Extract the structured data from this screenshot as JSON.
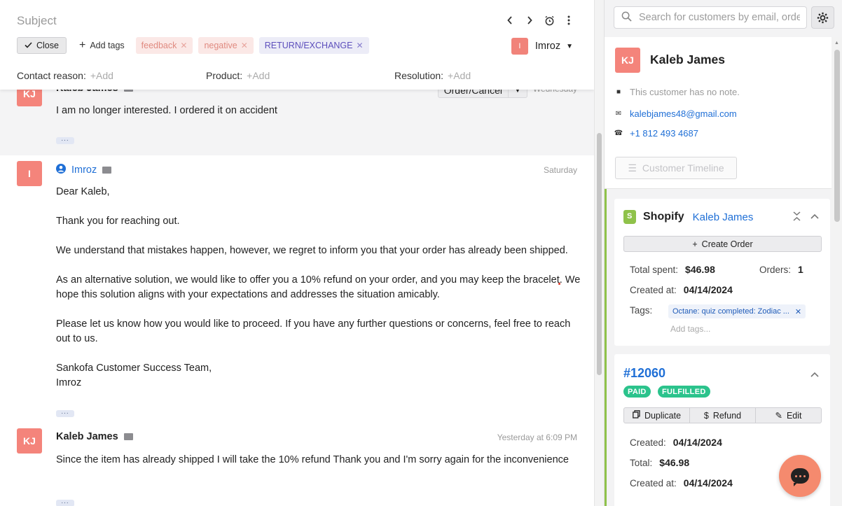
{
  "header": {
    "subject_placeholder": "Subject",
    "close_label": "Close",
    "add_tags_label": "Add tags",
    "tags": [
      "feedback",
      "negative",
      "RETURN/EXCHANGE"
    ],
    "assignee_initial": "I",
    "assignee_name": "Imroz",
    "fields": [
      {
        "label": "Contact reason:",
        "value": "+Add"
      },
      {
        "label": "Product:",
        "value": "+Add"
      },
      {
        "label": "Resolution:",
        "value": "+Add"
      }
    ],
    "icons": [
      "chevron-left-icon",
      "chevron-right-icon",
      "snooze-clock-icon",
      "more-vertical-icon"
    ]
  },
  "messages": [
    {
      "initials": "KJ",
      "sender": "Kaleb James",
      "time": "Wednesday",
      "intent": "Order/Cancel",
      "paragraphs": [
        "I am no longer interested. I ordered it on accident"
      ]
    },
    {
      "initials": "I",
      "sender": "Imroz",
      "time": "Saturday",
      "paragraphs": [
        "Dear Kaleb,",
        "Thank you for reaching out.",
        "We understand that mistakes happen, however, we regret to inform you that your order has already been shipped.",
        "As an alternative solution, we would like to offer you a 10% refund on your order, and you may keep the bracelet. We hope this solution aligns with your expectations and addresses the situation amicably.",
        "Please let us know how you would like to proceed. If you have any further questions or concerns, feel free to reach out to us.",
        "Sankofa Customer Success Team,\nImroz"
      ]
    },
    {
      "initials": "KJ",
      "sender": "Kaleb James",
      "time": "Yesterday at 6:09 PM",
      "paragraphs": [
        "Since the item has already shipped I will take the 10% refund Thank you and I'm sorry again for the inconvenience"
      ]
    }
  ],
  "sidebar": {
    "search_placeholder": "Search for customers by email, order",
    "customer": {
      "initials": "KJ",
      "name": "Kaleb James",
      "note": "This customer has no note.",
      "email": "kalebjames48@gmail.com",
      "phone": "+1 812 493 4687",
      "timeline_label": "Customer Timeline"
    },
    "shopify": {
      "title": "Shopify",
      "customer_link": "Kaleb James",
      "create_order_label": "Create Order",
      "total_spent_label": "Total spent:",
      "total_spent": "$46.98",
      "orders_label": "Orders:",
      "orders": "1",
      "created_label": "Created at:",
      "created": "04/14/2024",
      "tags_label": "Tags:",
      "tag": "Octane: quiz completed: Zodiac ...",
      "add_tags": "Add tags..."
    },
    "order": {
      "id": "#12060",
      "badges": [
        "PAID",
        "FULFILLED"
      ],
      "actions": [
        "Duplicate",
        "Refund",
        "Edit"
      ],
      "created_label": "Created:",
      "created": "04/14/2024",
      "total_label": "Total:",
      "total": "$46.98",
      "created_at_label": "Created at:",
      "created_at": "04/14/2024"
    }
  },
  "colors": {
    "avatar": "#f4847b",
    "link": "#1f6fd6",
    "shopify_green": "#8fc24a",
    "badge_green": "#2bc38c",
    "chat_button": "#f58a6e"
  }
}
